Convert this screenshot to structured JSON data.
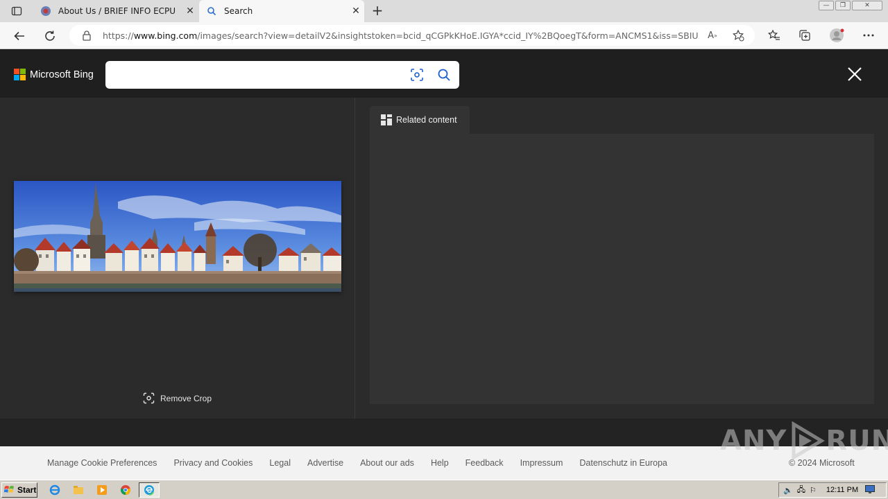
{
  "browser": {
    "tabs": [
      {
        "title": "About Us / BRIEF INFO ECPU",
        "close": "✕"
      },
      {
        "title": "Search",
        "close": "✕"
      }
    ],
    "new_tab": "+",
    "url_prefix": "https://",
    "url_host": "www.bing.com",
    "url_path": "/images/search?view=detailV2&insightstoken=bcid_qCGPkKHoE.IGYA*ccid_IY%2BQoegT&form=ANCMS1&iss=SBIU..."
  },
  "bing": {
    "brand": "Microsoft Bing",
    "logo_colors": [
      "#f25022",
      "#7fba00",
      "#00a4ef",
      "#ffb900"
    ],
    "search": {
      "value": "",
      "placeholder": ""
    }
  },
  "viewer": {
    "remove_crop_label": "Remove Crop",
    "related_tab_label": "Related content"
  },
  "footer": {
    "links": [
      "Manage Cookie Preferences",
      "Privacy and Cookies",
      "Legal",
      "Advertise",
      "About our ads",
      "Help",
      "Feedback",
      "Impressum",
      "Datenschutz in Europa"
    ],
    "copyright": "© 2024 Microsoft"
  },
  "watermark": {
    "left": "ANY",
    "right": "RUN"
  },
  "taskbar": {
    "start_label": "Start",
    "clock": "12:11 PM"
  }
}
